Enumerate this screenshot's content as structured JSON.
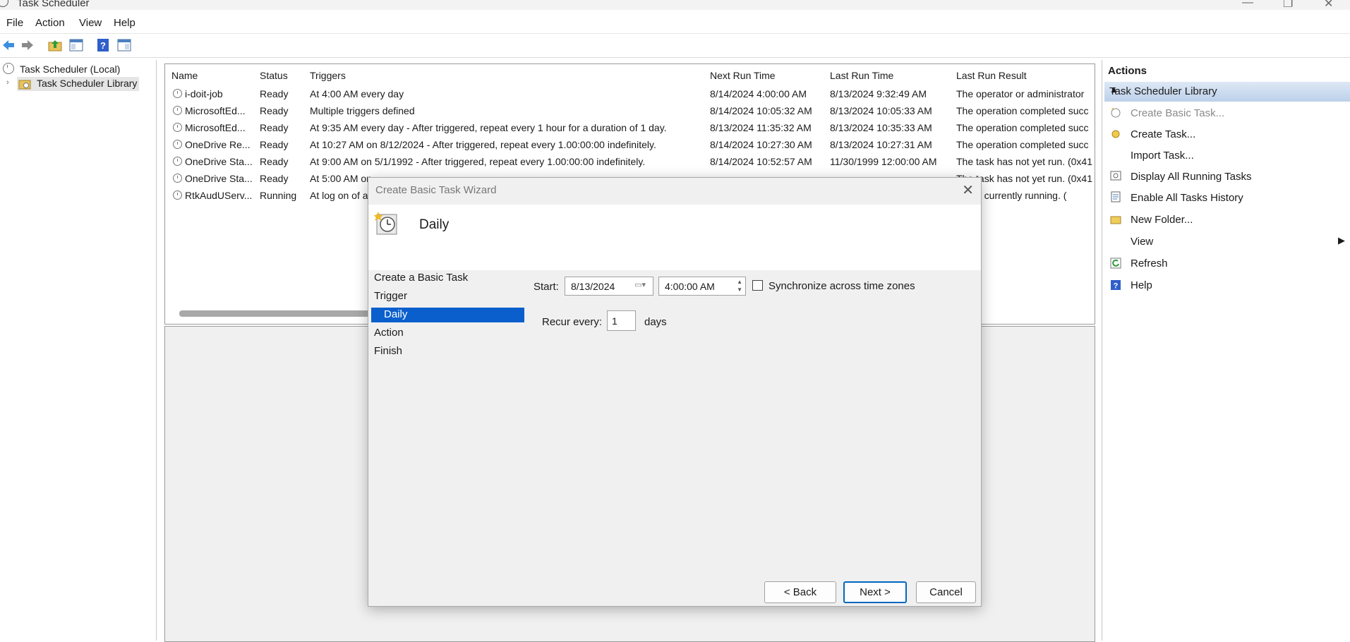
{
  "window": {
    "title": "Task Scheduler"
  },
  "menu": {
    "file": "File",
    "action": "Action",
    "view": "View",
    "help": "Help"
  },
  "tree": {
    "root": "Task Scheduler (Local)",
    "library": "Task Scheduler Library"
  },
  "table": {
    "headers": {
      "name": "Name",
      "status": "Status",
      "triggers": "Triggers",
      "next_run": "Next Run Time",
      "last_run": "Last Run Time",
      "result": "Last Run Result"
    },
    "rows": [
      {
        "name": "i-doit-job",
        "status": "Ready",
        "triggers": "At 4:00 AM every day",
        "next_run": "8/14/2024 4:00:00 AM",
        "last_run": "8/13/2024 9:32:49 AM",
        "result": "The operator or administrator"
      },
      {
        "name": "MicrosoftEd...",
        "status": "Ready",
        "triggers": "Multiple triggers defined",
        "next_run": "8/14/2024 10:05:32 AM",
        "last_run": "8/13/2024 10:05:33 AM",
        "result": "The operation completed succ"
      },
      {
        "name": "MicrosoftEd...",
        "status": "Ready",
        "triggers": "At 9:35 AM every day - After triggered, repeat every 1 hour for a duration of 1 day.",
        "next_run": "8/13/2024 11:35:32 AM",
        "last_run": "8/13/2024 10:35:33 AM",
        "result": "The operation completed succ"
      },
      {
        "name": "OneDrive Re...",
        "status": "Ready",
        "triggers": "At 10:27 AM on 8/12/2024 - After triggered, repeat every 1.00:00:00 indefinitely.",
        "next_run": "8/14/2024 10:27:30 AM",
        "last_run": "8/13/2024 10:27:31 AM",
        "result": "The operation completed succ"
      },
      {
        "name": "OneDrive Sta...",
        "status": "Ready",
        "triggers": "At 9:00 AM on 5/1/1992 - After triggered, repeat every 1.00:00:00 indefinitely.",
        "next_run": "8/14/2024 10:52:57 AM",
        "last_run": "11/30/1999 12:00:00 AM",
        "result": "The task has not yet run. (0x41"
      },
      {
        "name": "OneDrive Sta...",
        "status": "Ready",
        "triggers": "At 5:00 AM on",
        "next_run": "",
        "last_run": "",
        "result": "The task has not yet run. (0x41"
      },
      {
        "name": "RtkAudUServ...",
        "status": "Running",
        "triggers": "At log on of a",
        "next_run": "",
        "last_run": "",
        "result": "ask is currently running. ("
      }
    ]
  },
  "actions": {
    "header": "Actions",
    "section": "Task Scheduler Library",
    "items": {
      "create_basic": "Create Basic Task...",
      "create": "Create Task...",
      "import": "Import Task...",
      "display_running": "Display All Running Tasks",
      "enable_history": "Enable All Tasks History",
      "new_folder": "New Folder...",
      "view": "View",
      "refresh": "Refresh",
      "help": "Help"
    }
  },
  "dialog": {
    "title": "Create Basic Task Wizard",
    "heading": "Daily",
    "steps": {
      "create": "Create a Basic Task",
      "trigger": "Trigger",
      "daily": "Daily",
      "action": "Action",
      "finish": "Finish"
    },
    "start_label": "Start:",
    "start_date": "8/13/2024",
    "start_time": "4:00:00 AM",
    "sync_label": "Synchronize across time zones",
    "recur_label": "Recur every:",
    "recur_value": "1",
    "recur_unit": "days",
    "back": "< Back",
    "next": "Next >",
    "cancel": "Cancel"
  },
  "colors": {
    "selection": "#0a5fcc",
    "accent": "#0067c0"
  },
  "icons": [
    "back-arrow-icon",
    "forward-arrow-icon",
    "folder-up-icon",
    "show-hide-console-tree-icon",
    "help-icon",
    "action-pane-icon",
    "clock-icon",
    "wizard-clock-icon"
  ]
}
